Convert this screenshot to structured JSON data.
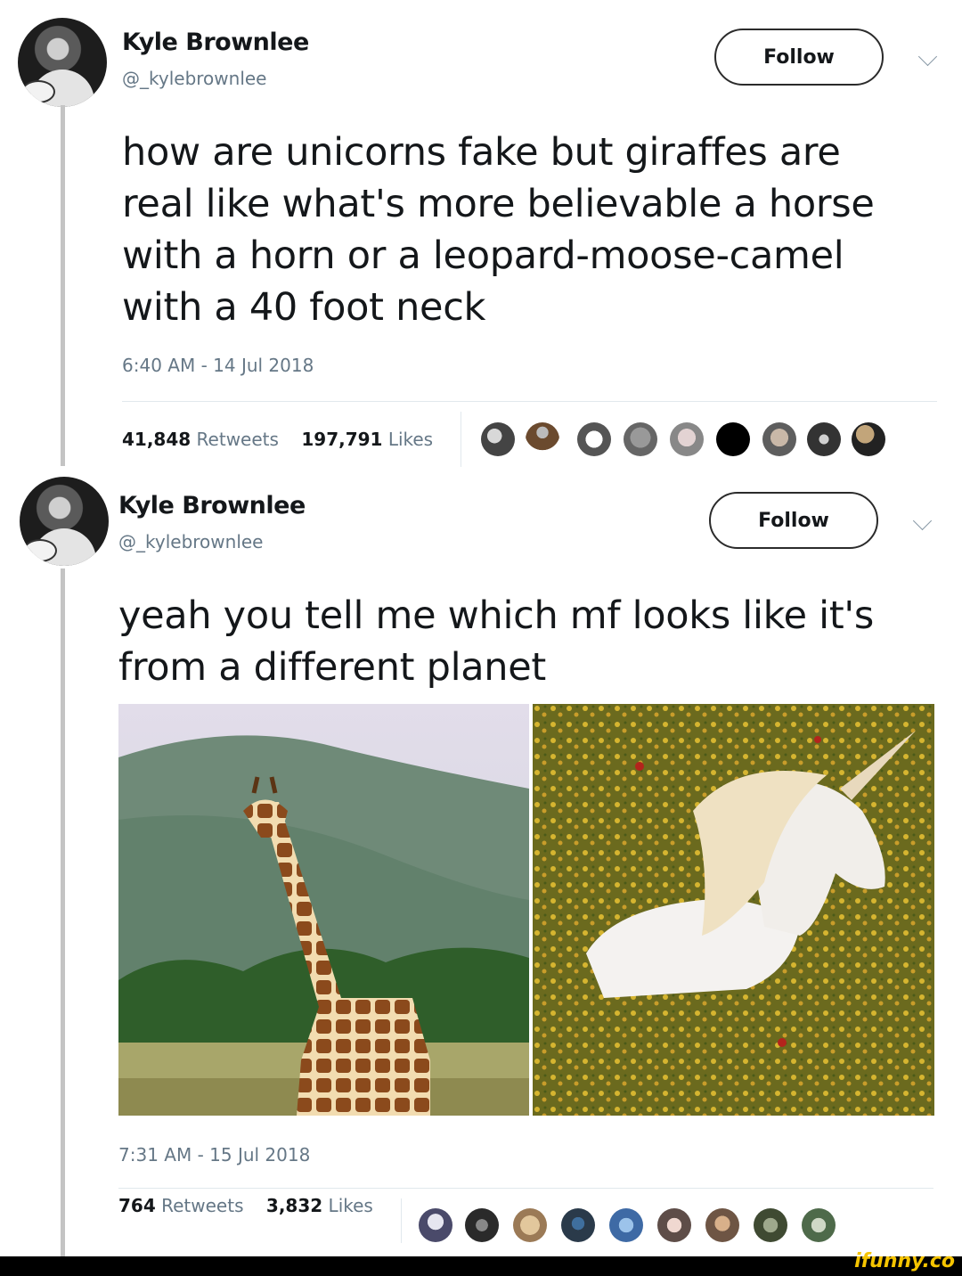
{
  "tweet1": {
    "name": "Kyle Brownlee",
    "handle": "@_kylebrownlee",
    "follow_label": "Follow",
    "text": "how are unicorns fake but giraffes are real like what's more believable a horse with a horn or a leopard-moose-camel with a 40 foot neck",
    "timestamp": "6:40 AM - 14 Jul 2018",
    "retweets_count": "41,848",
    "retweets_label": "Retweets",
    "likes_count": "197,791",
    "likes_label": "Likes"
  },
  "tweet2": {
    "name": "Kyle Brownlee",
    "handle": "@_kylebrownlee",
    "follow_label": "Follow",
    "text": "yeah you tell me which mf looks like it's from a different planet",
    "timestamp": "7:31 AM - 15 Jul 2018",
    "retweets_count": "764",
    "retweets_label": "Retweets",
    "likes_count": "3,832",
    "likes_label": "Likes"
  },
  "watermark": "ifunny.co",
  "colors": {
    "text": "#14171a",
    "secondary": "#657786",
    "divider": "#e1e8ed",
    "brand": "#f5c400"
  }
}
